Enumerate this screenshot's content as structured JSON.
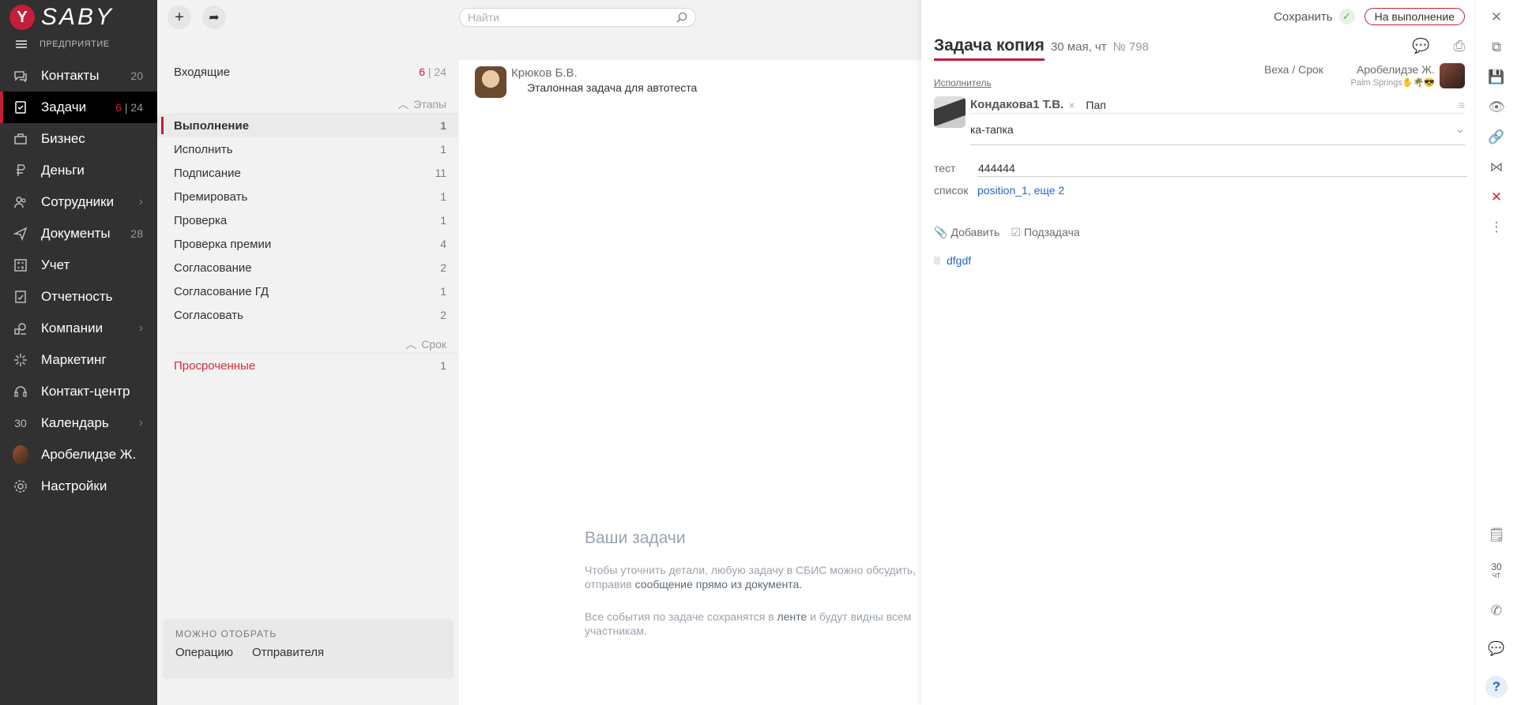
{
  "app": {
    "logo_letter": "Y",
    "logo_text": "SABY",
    "org_label": "ПРЕДПРИЯТИЕ"
  },
  "sidebar": {
    "items": [
      {
        "label": "Контакты",
        "count": "20",
        "icon": "chat-icon"
      },
      {
        "label": "Задачи",
        "count_red": "6",
        "count": "24",
        "icon": "tasks-icon",
        "active": true
      },
      {
        "label": "Бизнес",
        "icon": "business-icon"
      },
      {
        "label": "Деньги",
        "icon": "money-icon"
      },
      {
        "label": "Сотрудники",
        "icon": "employees-icon",
        "arrow": true
      },
      {
        "label": "Документы",
        "count": "28",
        "icon": "documents-icon"
      },
      {
        "label": "Учет",
        "icon": "accounting-icon"
      },
      {
        "label": "Отчетность",
        "icon": "reports-icon"
      },
      {
        "label": "Компании",
        "icon": "companies-icon",
        "arrow": true
      },
      {
        "label": "Маркетинг",
        "icon": "marketing-icon"
      },
      {
        "label": "Контакт-центр",
        "icon": "headset-icon"
      },
      {
        "label": "Календарь",
        "icon": "calendar-icon",
        "arrow": true,
        "icon_text": "30"
      },
      {
        "label": "Аробелидзе Ж.",
        "icon": "avatar"
      },
      {
        "label": "Настройки",
        "icon": "gear-icon"
      }
    ]
  },
  "search": {
    "placeholder": "Найти"
  },
  "filters": {
    "inbox": {
      "label": "Входящие",
      "count_red": "6",
      "count": "24"
    },
    "stages_header": "Этапы",
    "stages": [
      {
        "label": "Выполнение",
        "count": "1",
        "active": true
      },
      {
        "label": "Исполнить",
        "count": "1"
      },
      {
        "label": "Подписание",
        "count": "11"
      },
      {
        "label": "Премировать",
        "count": "1"
      },
      {
        "label": "Проверка",
        "count": "1"
      },
      {
        "label": "Проверка премии",
        "count": "4"
      },
      {
        "label": "Согласование",
        "count": "2"
      },
      {
        "label": "Согласование ГД",
        "count": "1"
      },
      {
        "label": "Согласовать",
        "count": "2"
      }
    ],
    "deadline_header": "Срок",
    "overdue": {
      "label": "Просроченные",
      "count": "1"
    },
    "can_select": {
      "caption": "МОЖНО ОТОБРАТЬ",
      "options": [
        "Операцию",
        "Отправителя"
      ]
    }
  },
  "task_list": {
    "items": [
      {
        "author": "Крюков Б.В.",
        "title": "Эталонная задача для автотеста"
      }
    ],
    "empty": {
      "title": "Ваши задачи",
      "p1_a": "Чтобы уточнить детали, любую задачу в СБИС можно обсудить,",
      "p1_b": "отправив ",
      "p1_link": "сообщение прямо из документа.",
      "p2_a": "Все события по задаче сохранятся в ",
      "p2_link": "ленте",
      "p2_b": " и будут видны всем",
      "p2_c": "участникам."
    }
  },
  "task_panel": {
    "save_label": "Сохранить",
    "status_label": "На выполнение",
    "title": "Задача копия",
    "date": "30 мая, чт",
    "number": "№ 798",
    "executor_label": "Исполнитель",
    "milestone_label": "Веха / Срок",
    "author_name": "Аробелидзе Ж.",
    "author_location": "Palm Springs✋🌴😎",
    "executor_name": "Кондакова1 Т.В.",
    "executor_role": "Пап",
    "description": "ка-тапка",
    "fields": [
      {
        "label": "тест",
        "value": "444444"
      },
      {
        "label": "список",
        "value": "position_1, еще 2"
      }
    ],
    "add_label": "Добавить",
    "subtask_label": "Подзадача",
    "attachment": "dfgdf"
  },
  "rail": {
    "calendar_day": "30",
    "calendar_weekday": "ЧТ"
  }
}
